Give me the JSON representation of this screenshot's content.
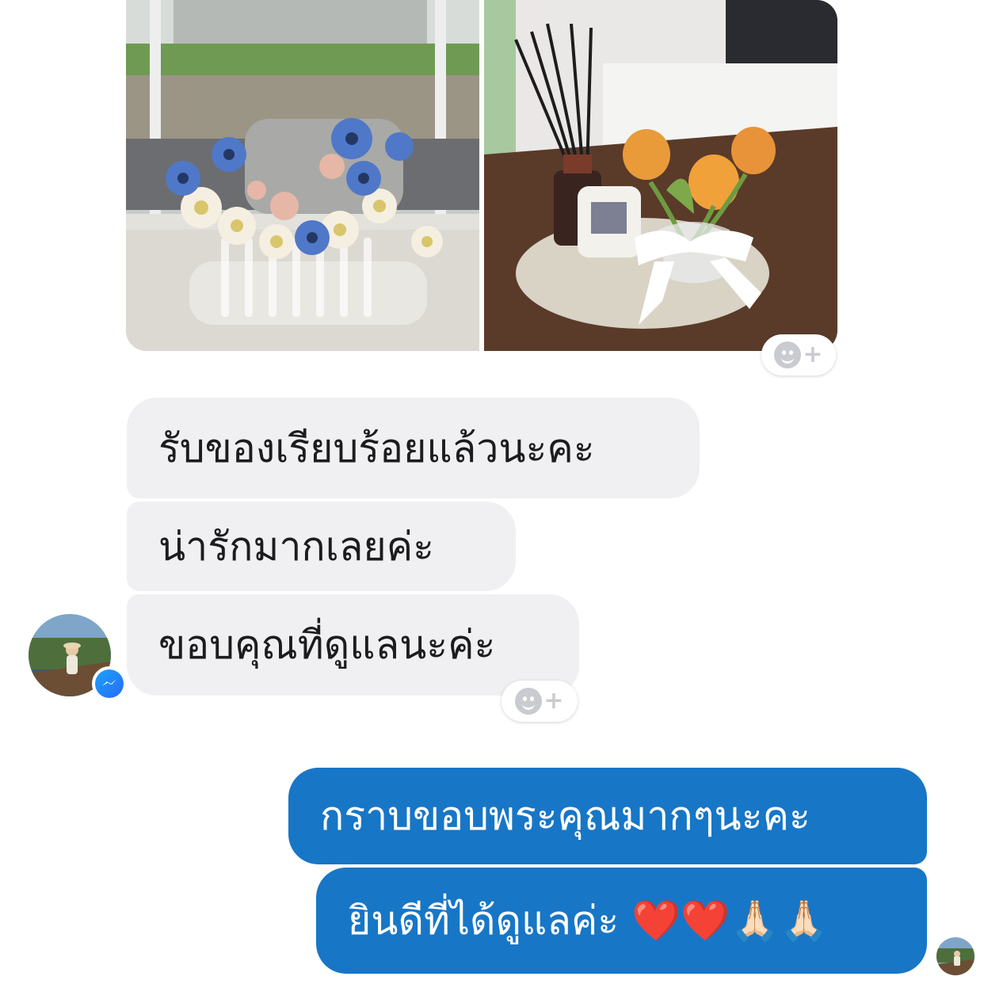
{
  "thread": {
    "photo_attachments": [
      {
        "name": "flower-vase-photo"
      },
      {
        "name": "tulip-diffuser-photo"
      }
    ],
    "incoming_messages": [
      "รับของเรียบร้อยแล้วนะคะ",
      "น่ารักมากเลยค่ะ",
      "ขอบคุณที่ดูแลนะค่ะ"
    ],
    "outgoing_messages": [
      "กราบขอบพระคุณมากๆนะคะ",
      "ยินดีที่ได้ดูแลค่ะ ❤️❤️🙏🏻🙏🏻"
    ],
    "reaction_icon": "add-reaction-icon",
    "badge_icon": "messenger-icon",
    "colors": {
      "incoming_bubble": "#f0f0f2",
      "outgoing_bubble": "#1776c6",
      "messenger_badge": "#2a6af5"
    }
  }
}
